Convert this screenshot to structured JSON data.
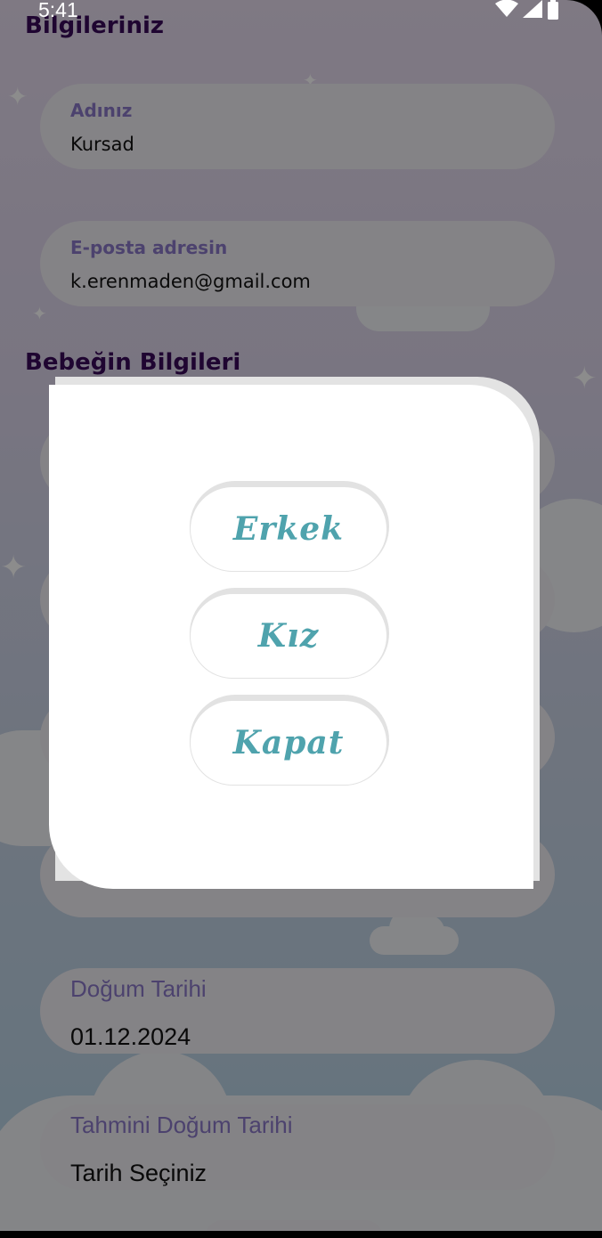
{
  "status_bar": {
    "time": "5:41",
    "icons": [
      "wifi-icon",
      "signal-icon",
      "battery-icon"
    ]
  },
  "sections": {
    "parent_title": "Bilgileriniz",
    "baby_title": "Bebeğin Bilgileri"
  },
  "fields": {
    "name": {
      "label": "Adınız",
      "value": "Kursad"
    },
    "email": {
      "label": "E-posta adresin",
      "value": "k.erenmaden@gmail.com"
    },
    "birth_date": {
      "label": "Doğum Tarihi",
      "value": "01.12.2024"
    },
    "due_date": {
      "label": "Tahmini Doğum Tarihi",
      "value": "Tarih Seçiniz"
    }
  },
  "dialog": {
    "options": {
      "male": "Erkek",
      "female": "Kız",
      "close": "Kapat"
    }
  },
  "colors": {
    "accent_teal": "#4fa3ad",
    "title_purple": "#3a0a5a",
    "label_purple": "#8a78c8",
    "scrim": "rgba(0,0,0,0.45)"
  }
}
